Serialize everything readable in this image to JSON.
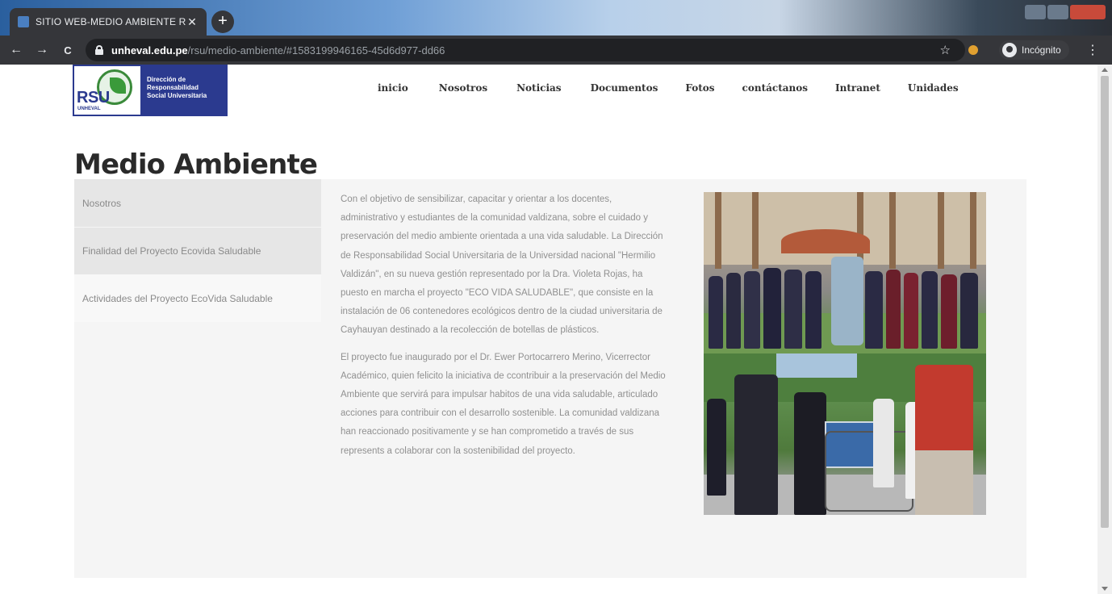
{
  "browser": {
    "tab_title": "SITIO WEB-MEDIO AMBIENTE R",
    "tab_close": "✕",
    "new_tab": "+",
    "url_host": "unheval.edu.pe",
    "url_path": "/rsu/medio-ambiente/#1583199946165-45d6d977-dd66",
    "profile_label": "Incógnito",
    "back": "←",
    "forward": "→",
    "reload": "C",
    "star": "☆",
    "menu": "⋮"
  },
  "logo": {
    "rsu": "RSU",
    "unheval": "UNHEVAL",
    "line1": "Dirección de",
    "line2": "Responsabilidad",
    "line3": "Social Universitaria"
  },
  "nav": {
    "items": [
      "inicio",
      "Nosotros",
      "Noticias",
      "Documentos",
      "Fotos",
      "contáctanos",
      "Intranet",
      "Unidades"
    ]
  },
  "page": {
    "title": "Medio Ambiente"
  },
  "sidebar": {
    "items": [
      "Nosotros",
      "Finalidad del Proyecto Ecovida Saludable",
      "Actividades del Proyecto EcoVida Saludable"
    ]
  },
  "article": {
    "paragraphs": [
      "Con el objetivo de sensibilizar, capacitar y orientar a los docentes, administrativo y estudiantes de la comunidad valdizana, sobre el cuidado y preservación del medio ambiente orientada a una vida saludable. La Dirección de Responsabilidad Social Universitaria de la Universidad nacional \"Hermilio Valdizán\", en su nueva gestión representado por la Dra. Violeta Rojas, ha puesto en marcha el proyecto \"ECO VIDA SALUDABLE\", que consiste en la instalación de 06 contenedores ecológicos dentro de la ciudad universitaria de Cayhauyan destinado a la recolección de botellas de plásticos.",
      "El proyecto fue inaugurado por el Dr. Ewer Portocarrero Merino, Vicerrector Académico, quien felicito la iniciativa de ccontribuir a la preservación del Medio Ambiente que servirá para impulsar habitos de una vida saludable, articulado acciones para contribuir con el desarrollo sostenible. La comunidad valdizana han reaccionado positivamente y se han comprometido a través de sus represents a colaborar con la sostenibilidad del proyecto."
    ]
  }
}
